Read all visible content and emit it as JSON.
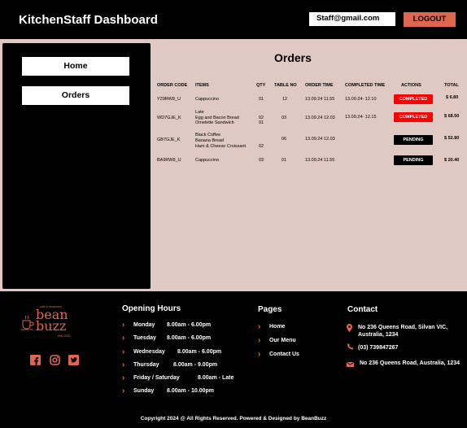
{
  "header": {
    "title": "KitchenStaff Dashboard",
    "email": "Staff@gmail.com",
    "logout_label": "LOGOUT"
  },
  "sidebar": {
    "items": [
      {
        "label": "Home"
      },
      {
        "label": "Orders"
      }
    ]
  },
  "orders": {
    "title": "Orders",
    "columns": [
      "ORDER CODE",
      "ITEMS",
      "QTY",
      "TABLE NO",
      "ORDER TIME",
      "COMPLETED TIME",
      "ACTIONS",
      "TOTAL"
    ],
    "rows": [
      {
        "code": "Y29RW8_U",
        "items": [
          "Cappuccino"
        ],
        "qty": [
          "01"
        ],
        "table": "12",
        "order_time": "13.09.24 11.55",
        "completed_time": "13.09.24- 12.10",
        "action": "COMPLETED",
        "total": "$ 6.80"
      },
      {
        "code": "WD7GJE_K",
        "items": [
          "Late",
          "Egg and Bacon Bread",
          "Omelette Sandwich"
        ],
        "qty": [
          "02",
          "01"
        ],
        "table": "03",
        "order_time": "13.09.24 12.03",
        "completed_time": "13.09.24- 12.15",
        "action": "COMPLETED",
        "total": "$ 68.50"
      },
      {
        "code": "GB7GJE_K",
        "items": [
          "Black Coffee",
          "Banana Bread",
          "Ham & Cheese Croissant"
        ],
        "qty": [
          "02"
        ],
        "table": "06",
        "order_time": "13.09.24 12.03",
        "completed_time": "",
        "action": "PENDING",
        "total": "$ 52.80"
      },
      {
        "code": "BA9RW8_U",
        "items": [
          "Cappuccino"
        ],
        "qty": [
          "03"
        ],
        "table": "01",
        "order_time": "13.09.24 11.55",
        "completed_time": "",
        "action": "PENDING",
        "total": "$ 20.40"
      }
    ]
  },
  "footer": {
    "logo": {
      "top_text": "cafe & restaurant",
      "name_line1": "bean",
      "name_line2": "buzz",
      "est": "estd 2020"
    },
    "social_icons": [
      "facebook-icon",
      "instagram-icon",
      "twitter-icon"
    ],
    "opening_hours": {
      "title": "Opening Hours",
      "rows": [
        {
          "day": "Monday",
          "hours": "8.00am  -  6.00pm"
        },
        {
          "day": "Tuesday",
          "hours": "8.00am  -  6.00pm"
        },
        {
          "day": "Wednesday",
          "hours": "8.00am  -  6.00pm"
        },
        {
          "day": "Thursday",
          "hours": "8.00am  -  9.00pm"
        },
        {
          "day": "Friday  /   Saturday",
          "hours": "8.00am  -  Late"
        },
        {
          "day": "Sunday",
          "hours": "8.00am  -  10.00pm"
        }
      ]
    },
    "pages": {
      "title": "Pages",
      "links": [
        "Home",
        "Our Menu",
        "Contact Us"
      ]
    },
    "contact": {
      "title": "Contact",
      "address": "No 236 Queens Road, Silvan VIC, Australia, 1234",
      "phone": "(03) 739847267",
      "email_address": "No 236 Queens Road,  Australia, 1234"
    },
    "copyright": "Copyright 2024 @ All Rights Reserved. Powered & Designed by BeanBuzz"
  },
  "colors": {
    "accent": "#e0674f",
    "main_bg": "#e0c9c3",
    "complete": "#ff0000",
    "pending": "#000000"
  }
}
